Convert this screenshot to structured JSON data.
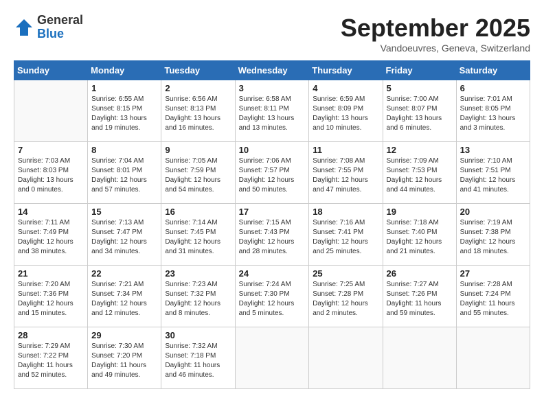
{
  "header": {
    "logo_general": "General",
    "logo_blue": "Blue",
    "month_title": "September 2025",
    "location": "Vandoeuvres, Geneva, Switzerland"
  },
  "weekdays": [
    "Sunday",
    "Monday",
    "Tuesday",
    "Wednesday",
    "Thursday",
    "Friday",
    "Saturday"
  ],
  "weeks": [
    [
      {
        "day": "",
        "info": ""
      },
      {
        "day": "1",
        "info": "Sunrise: 6:55 AM\nSunset: 8:15 PM\nDaylight: 13 hours\nand 19 minutes."
      },
      {
        "day": "2",
        "info": "Sunrise: 6:56 AM\nSunset: 8:13 PM\nDaylight: 13 hours\nand 16 minutes."
      },
      {
        "day": "3",
        "info": "Sunrise: 6:58 AM\nSunset: 8:11 PM\nDaylight: 13 hours\nand 13 minutes."
      },
      {
        "day": "4",
        "info": "Sunrise: 6:59 AM\nSunset: 8:09 PM\nDaylight: 13 hours\nand 10 minutes."
      },
      {
        "day": "5",
        "info": "Sunrise: 7:00 AM\nSunset: 8:07 PM\nDaylight: 13 hours\nand 6 minutes."
      },
      {
        "day": "6",
        "info": "Sunrise: 7:01 AM\nSunset: 8:05 PM\nDaylight: 13 hours\nand 3 minutes."
      }
    ],
    [
      {
        "day": "7",
        "info": "Sunrise: 7:03 AM\nSunset: 8:03 PM\nDaylight: 13 hours\nand 0 minutes."
      },
      {
        "day": "8",
        "info": "Sunrise: 7:04 AM\nSunset: 8:01 PM\nDaylight: 12 hours\nand 57 minutes."
      },
      {
        "day": "9",
        "info": "Sunrise: 7:05 AM\nSunset: 7:59 PM\nDaylight: 12 hours\nand 54 minutes."
      },
      {
        "day": "10",
        "info": "Sunrise: 7:06 AM\nSunset: 7:57 PM\nDaylight: 12 hours\nand 50 minutes."
      },
      {
        "day": "11",
        "info": "Sunrise: 7:08 AM\nSunset: 7:55 PM\nDaylight: 12 hours\nand 47 minutes."
      },
      {
        "day": "12",
        "info": "Sunrise: 7:09 AM\nSunset: 7:53 PM\nDaylight: 12 hours\nand 44 minutes."
      },
      {
        "day": "13",
        "info": "Sunrise: 7:10 AM\nSunset: 7:51 PM\nDaylight: 12 hours\nand 41 minutes."
      }
    ],
    [
      {
        "day": "14",
        "info": "Sunrise: 7:11 AM\nSunset: 7:49 PM\nDaylight: 12 hours\nand 38 minutes."
      },
      {
        "day": "15",
        "info": "Sunrise: 7:13 AM\nSunset: 7:47 PM\nDaylight: 12 hours\nand 34 minutes."
      },
      {
        "day": "16",
        "info": "Sunrise: 7:14 AM\nSunset: 7:45 PM\nDaylight: 12 hours\nand 31 minutes."
      },
      {
        "day": "17",
        "info": "Sunrise: 7:15 AM\nSunset: 7:43 PM\nDaylight: 12 hours\nand 28 minutes."
      },
      {
        "day": "18",
        "info": "Sunrise: 7:16 AM\nSunset: 7:41 PM\nDaylight: 12 hours\nand 25 minutes."
      },
      {
        "day": "19",
        "info": "Sunrise: 7:18 AM\nSunset: 7:40 PM\nDaylight: 12 hours\nand 21 minutes."
      },
      {
        "day": "20",
        "info": "Sunrise: 7:19 AM\nSunset: 7:38 PM\nDaylight: 12 hours\nand 18 minutes."
      }
    ],
    [
      {
        "day": "21",
        "info": "Sunrise: 7:20 AM\nSunset: 7:36 PM\nDaylight: 12 hours\nand 15 minutes."
      },
      {
        "day": "22",
        "info": "Sunrise: 7:21 AM\nSunset: 7:34 PM\nDaylight: 12 hours\nand 12 minutes."
      },
      {
        "day": "23",
        "info": "Sunrise: 7:23 AM\nSunset: 7:32 PM\nDaylight: 12 hours\nand 8 minutes."
      },
      {
        "day": "24",
        "info": "Sunrise: 7:24 AM\nSunset: 7:30 PM\nDaylight: 12 hours\nand 5 minutes."
      },
      {
        "day": "25",
        "info": "Sunrise: 7:25 AM\nSunset: 7:28 PM\nDaylight: 12 hours\nand 2 minutes."
      },
      {
        "day": "26",
        "info": "Sunrise: 7:27 AM\nSunset: 7:26 PM\nDaylight: 11 hours\nand 59 minutes."
      },
      {
        "day": "27",
        "info": "Sunrise: 7:28 AM\nSunset: 7:24 PM\nDaylight: 11 hours\nand 55 minutes."
      }
    ],
    [
      {
        "day": "28",
        "info": "Sunrise: 7:29 AM\nSunset: 7:22 PM\nDaylight: 11 hours\nand 52 minutes."
      },
      {
        "day": "29",
        "info": "Sunrise: 7:30 AM\nSunset: 7:20 PM\nDaylight: 11 hours\nand 49 minutes."
      },
      {
        "day": "30",
        "info": "Sunrise: 7:32 AM\nSunset: 7:18 PM\nDaylight: 11 hours\nand 46 minutes."
      },
      {
        "day": "",
        "info": ""
      },
      {
        "day": "",
        "info": ""
      },
      {
        "day": "",
        "info": ""
      },
      {
        "day": "",
        "info": ""
      }
    ]
  ]
}
